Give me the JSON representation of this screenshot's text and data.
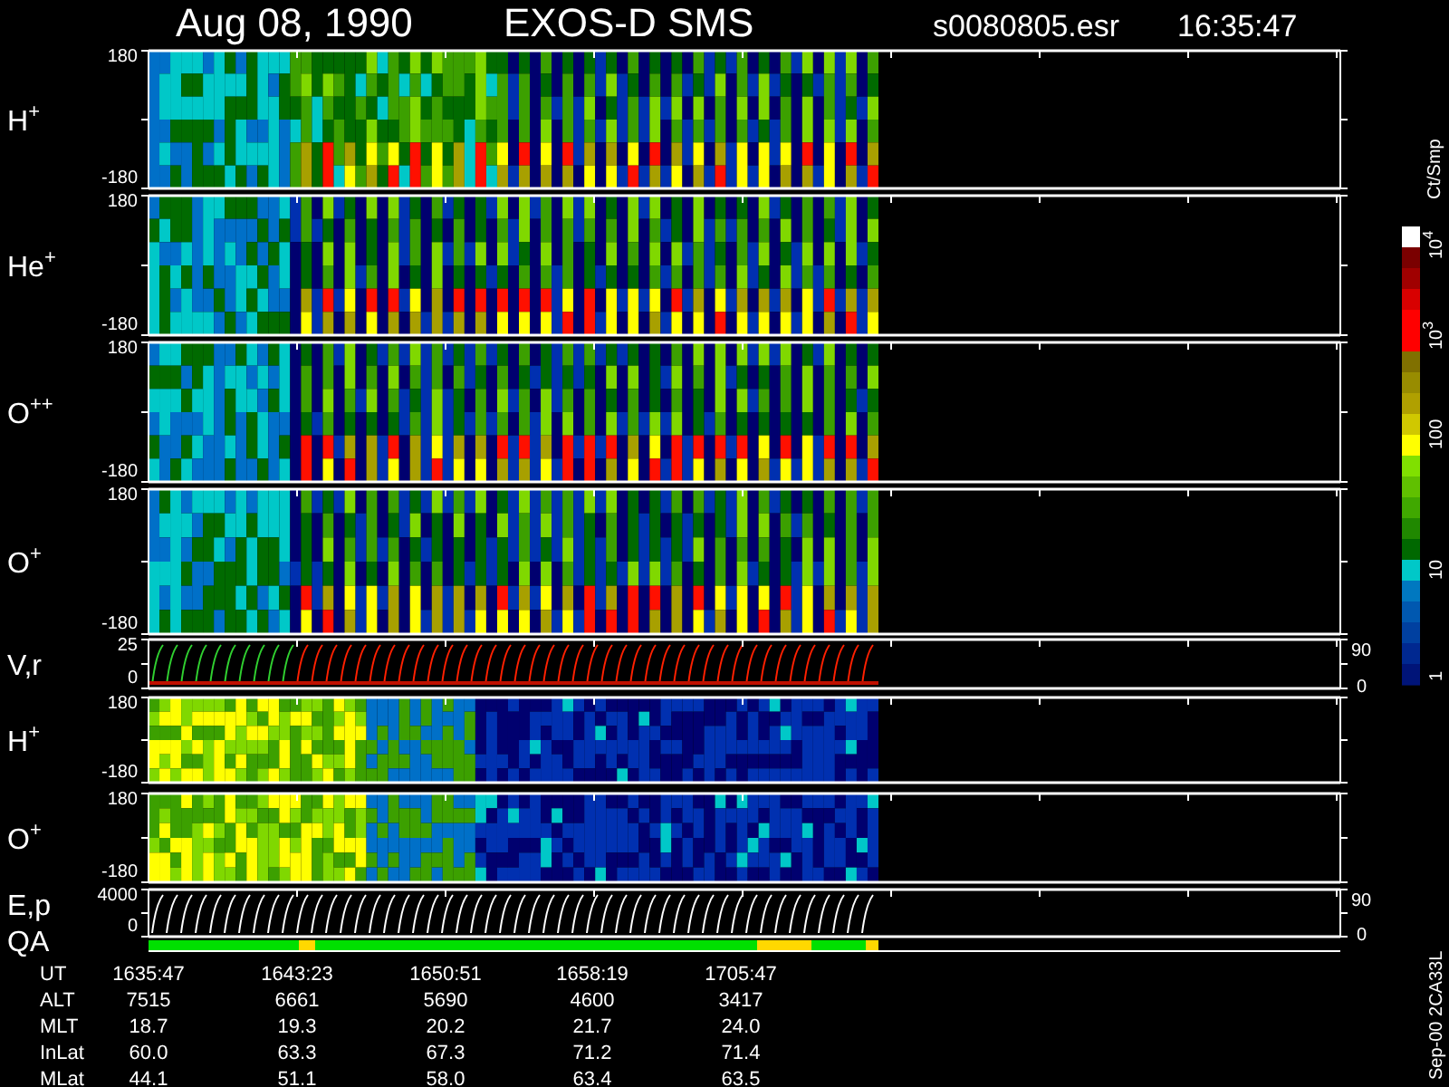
{
  "header": {
    "date": "Aug 08, 1990",
    "instrument": "EXOS-D SMS",
    "file": "s0080805.esr",
    "time": "16:35:47"
  },
  "panels": [
    {
      "kind": "spectrogram",
      "label": "H",
      "sup": "+",
      "top_tick": "180",
      "bottom_tick": "-180"
    },
    {
      "kind": "spectrogram",
      "label": "He",
      "sup": "+",
      "top_tick": "180",
      "bottom_tick": "-180"
    },
    {
      "kind": "spectrogram",
      "label": "O",
      "sup": "++",
      "top_tick": "180",
      "bottom_tick": "-180"
    },
    {
      "kind": "spectrogram",
      "label": "O",
      "sup": "+",
      "top_tick": "180",
      "bottom_tick": "-180"
    },
    {
      "kind": "trace",
      "label": "V,r",
      "top_tick": "25",
      "bottom_tick": "0",
      "right_top_tick": "90",
      "right_bottom_tick": "0"
    },
    {
      "kind": "spectrogram",
      "label": "H",
      "sup": "+",
      "top_tick": "180",
      "bottom_tick": "-180"
    },
    {
      "kind": "spectrogram",
      "label": "O",
      "sup": "+",
      "top_tick": "180",
      "bottom_tick": "-180"
    },
    {
      "kind": "trace",
      "label": "E,p",
      "second_label": "QA",
      "top_tick": "4000",
      "bottom_tick": "0",
      "right_top_tick": "90",
      "right_bottom_tick": "0"
    }
  ],
  "colorbar": {
    "unit": "Ct/Smp",
    "ticks": [
      {
        "base": "10",
        "sup": "4"
      },
      {
        "base": "10",
        "sup": "3"
      },
      {
        "base": "100"
      },
      {
        "base": "10"
      },
      {
        "base": "1"
      }
    ]
  },
  "table": [
    {
      "label": "UT",
      "values": [
        "1635:47",
        "1643:23",
        "1650:51",
        "1658:19",
        "1705:47"
      ]
    },
    {
      "label": "ALT",
      "values": [
        "7515",
        "6661",
        "5690",
        "4600",
        "3417"
      ]
    },
    {
      "label": "MLT",
      "values": [
        "18.7",
        "19.3",
        "20.2",
        "21.7",
        "24.0"
      ]
    },
    {
      "label": "InLat",
      "values": [
        "60.0",
        "63.3",
        "67.3",
        "71.2",
        "71.4"
      ]
    },
    {
      "label": "MLat",
      "values": [
        "44.1",
        "51.1",
        "58.0",
        "63.4",
        "63.5"
      ]
    }
  ],
  "footer": "Sep-00 2CA33L"
}
